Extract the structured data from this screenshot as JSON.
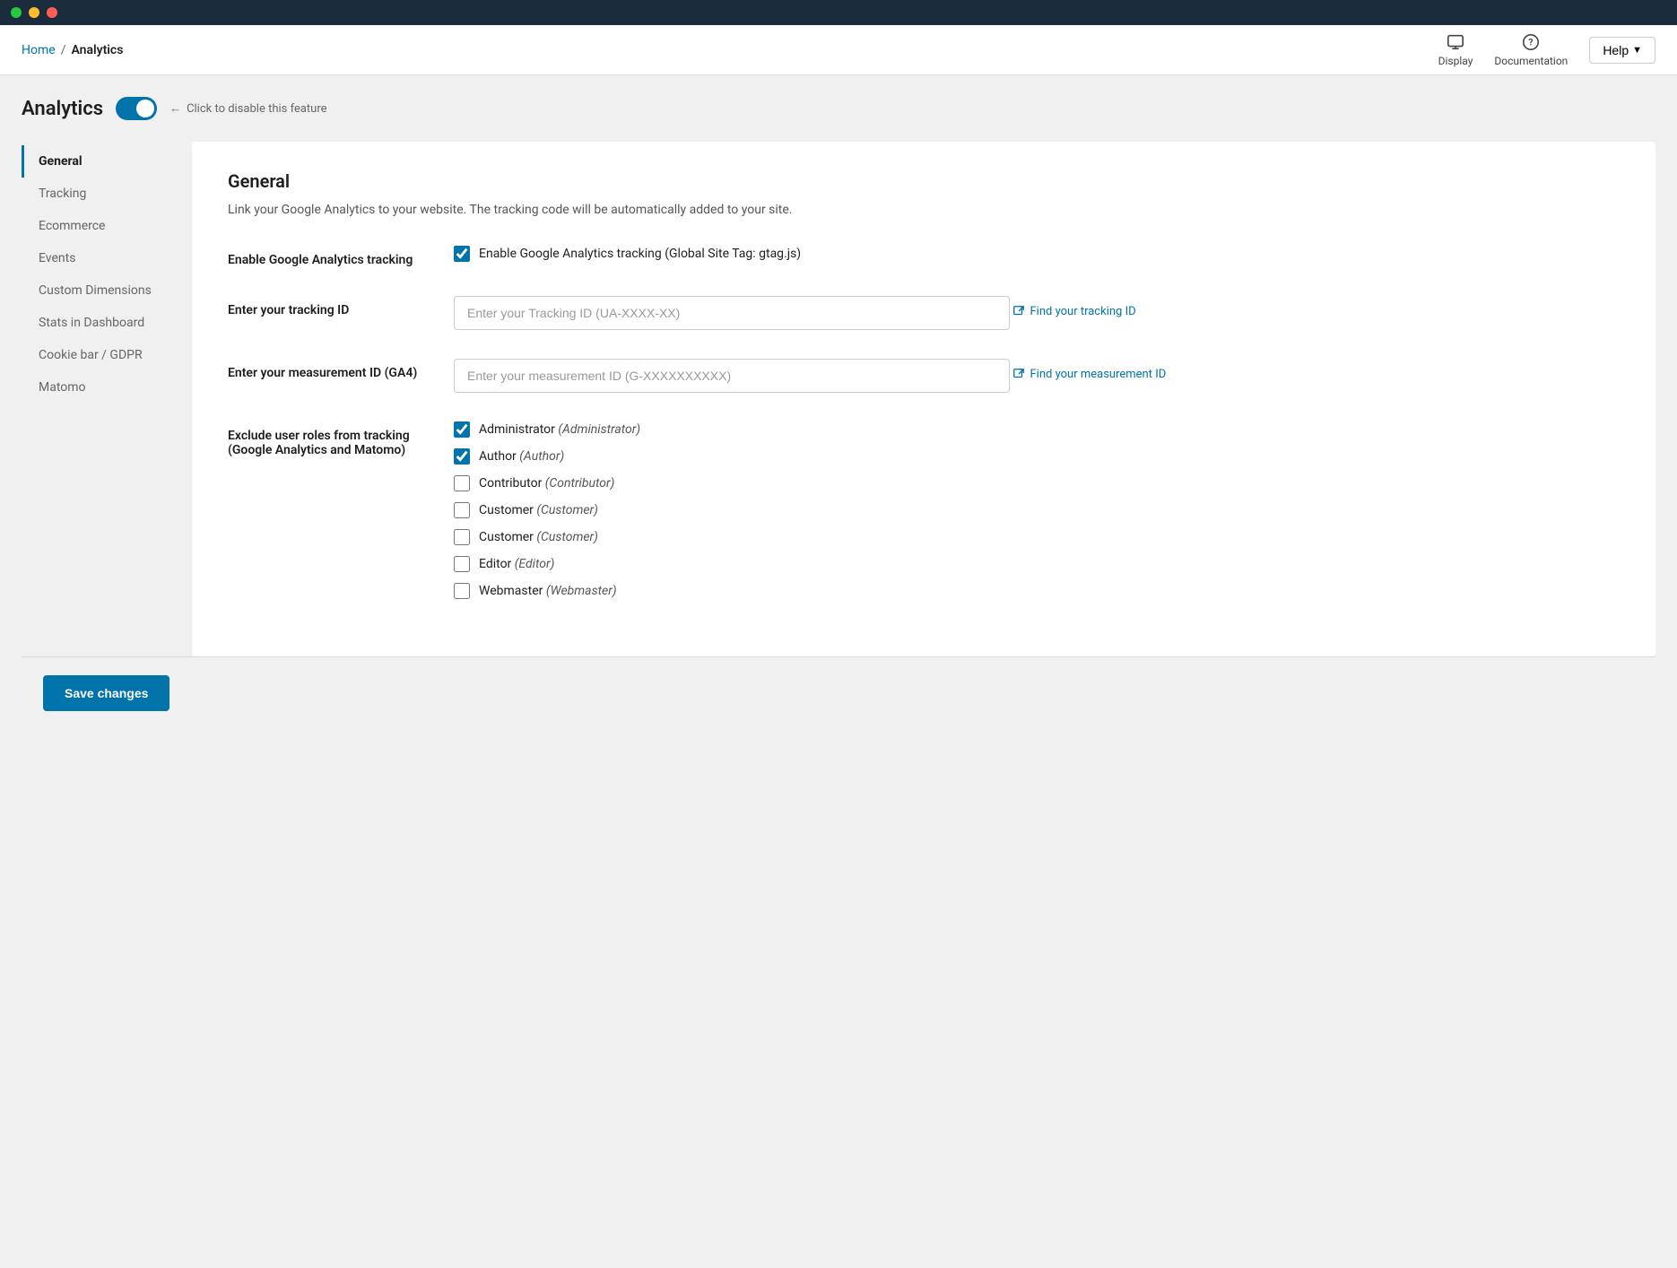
{
  "titleBar": {
    "lights": [
      "green",
      "yellow",
      "red"
    ]
  },
  "topNav": {
    "breadcrumb": {
      "home": "Home",
      "separator": "/",
      "current": "Analytics"
    },
    "navItems": [
      {
        "id": "display",
        "label": "Display"
      },
      {
        "id": "documentation",
        "label": "Documentation"
      }
    ],
    "helpButton": "Help"
  },
  "analyticsHeader": {
    "title": "Analytics",
    "toggleEnabled": true,
    "disableHint": "Click to disable this feature"
  },
  "sidebar": {
    "items": [
      {
        "id": "general",
        "label": "General",
        "active": true
      },
      {
        "id": "tracking",
        "label": "Tracking"
      },
      {
        "id": "ecommerce",
        "label": "Ecommerce"
      },
      {
        "id": "events",
        "label": "Events"
      },
      {
        "id": "custom-dimensions",
        "label": "Custom Dimensions"
      },
      {
        "id": "stats-in-dashboard",
        "label": "Stats in Dashboard"
      },
      {
        "id": "cookie-bar-gdpr",
        "label": "Cookie bar / GDPR"
      },
      {
        "id": "matomo",
        "label": "Matomo"
      }
    ]
  },
  "mainContent": {
    "sectionTitle": "General",
    "sectionDesc": "Link your Google Analytics to your website. The tracking code will be automatically added to your site.",
    "formRows": [
      {
        "id": "enable-ga",
        "label": "Enable Google Analytics tracking",
        "checkboxChecked": true,
        "checkboxLabel": "Enable Google Analytics tracking (Global Site Tag: gtag.js)"
      }
    ],
    "trackingId": {
      "label": "Enter your tracking ID",
      "placeholder": "Enter your Tracking ID (UA-XXXX-XX)",
      "value": "",
      "findLink": "Find your tracking ID"
    },
    "measurementId": {
      "label": "Enter your measurement ID (GA4)",
      "placeholder": "Enter your measurement ID (G-XXXXXXXXXX)",
      "value": "",
      "findLink": "Find your measurement ID"
    },
    "excludeRoles": {
      "label": "Exclude user roles from tracking (Google Analytics and Matomo)",
      "roles": [
        {
          "id": "administrator",
          "label": "Administrator",
          "italic": "Administrator",
          "checked": true
        },
        {
          "id": "author",
          "label": "Author",
          "italic": "Author",
          "checked": true
        },
        {
          "id": "contributor",
          "label": "Contributor",
          "italic": "Contributor",
          "checked": false
        },
        {
          "id": "customer1",
          "label": "Customer",
          "italic": "Customer",
          "checked": false
        },
        {
          "id": "customer2",
          "label": "Customer",
          "italic": "Customer",
          "checked": false
        },
        {
          "id": "editor",
          "label": "Editor",
          "italic": "Editor",
          "checked": false
        },
        {
          "id": "webmaster",
          "label": "Webmaster",
          "italic": "Webmaster",
          "checked": false
        }
      ]
    }
  },
  "saveButton": "Save changes"
}
